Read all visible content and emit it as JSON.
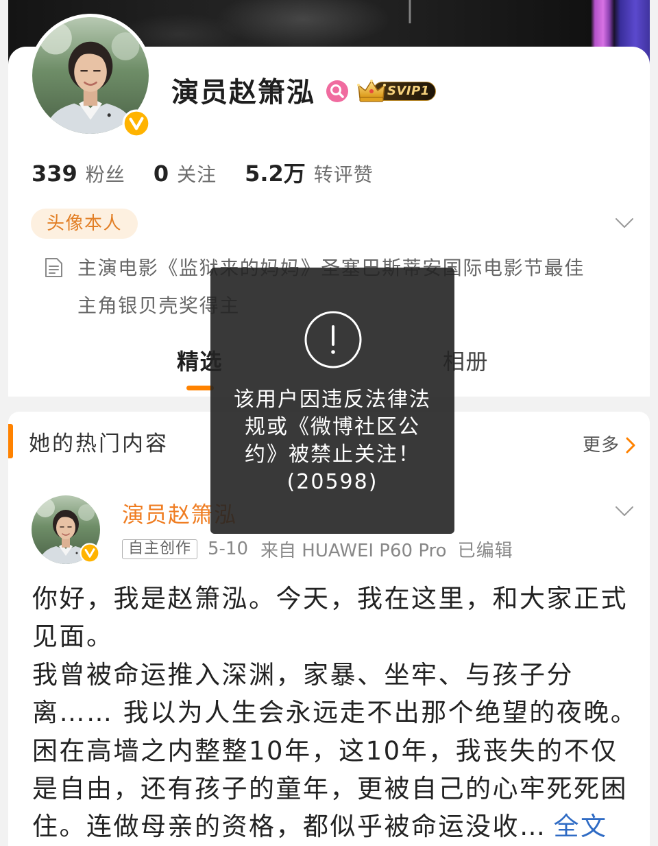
{
  "profile": {
    "name": "演员赵箫泓",
    "vip_label": "SVIP1",
    "stats": [
      {
        "value": "339",
        "label": "粉丝"
      },
      {
        "value": "0",
        "label": "关注"
      },
      {
        "value": "5.2万",
        "label": "转评赞"
      }
    ],
    "tag": "头像本人",
    "description_lines": [
      "主演电影《监狱来的妈妈》圣塞巴斯蒂安国际电影节最佳",
      "主角银贝壳奖得主"
    ]
  },
  "tabs": {
    "items": [
      {
        "label": "精选",
        "active": true
      },
      {
        "label": "相册",
        "active": false
      }
    ]
  },
  "hot_section": {
    "title": "她的热门内容",
    "more_label": "更多"
  },
  "post": {
    "author": "演员赵箫泓",
    "source_tag": "自主创作",
    "date": "5-10",
    "device": "来自 HUAWEI P60 Pro",
    "edited": "已编辑",
    "lines": [
      "你好，我是赵箫泓。今天，我在这里，和大家正式",
      "见面。",
      "我曾被命运推入深渊，家暴、坐牢、与孩子分",
      "离…… 我以为人生会永远走不出那个绝望的夜晚。",
      "困在高墙之内整整10年，这10年，我丧失的不仅",
      "是自由，还有孩子的童年，更被自己的心牢死死困",
      "住。连做母亲的资格，都似乎被命运没收…"
    ],
    "more_link": "全文"
  },
  "toast": {
    "lines": [
      "该用户因违反法律法",
      "规或《微博社区公",
      "约》被禁止关注！",
      "(20598)"
    ]
  },
  "icons": {
    "verified": "verified-badge-icon",
    "search": "magnifier-icon",
    "vip": "crown-icon",
    "expand": "chevron-down-icon",
    "description": "document-icon",
    "more": "chevron-right-icon",
    "alert": "exclamation-circle-icon"
  },
  "colors": {
    "accent": "#ff8200",
    "vip_name": "#ef7d22",
    "link": "#2f6bc4",
    "verified": "#ffb300",
    "tag_bg": "#fdf0e0",
    "tag_text": "#e27f26",
    "toast_bg": "#232323"
  }
}
